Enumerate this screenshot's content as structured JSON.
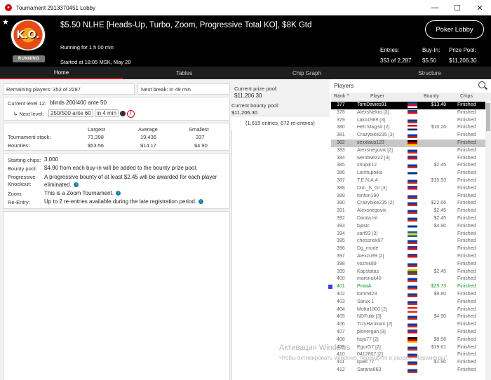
{
  "window": {
    "title": "Tournament 2913370451 Lobby",
    "buttons": [
      "—",
      "☐",
      "✕"
    ]
  },
  "header": {
    "badge_text": "K.O.",
    "running_label": "RUNNING",
    "title": "$5.50 NLHE [Heads-Up, Turbo, Zoom, Progressive Total KO], $8K Gtd",
    "running_for": "Running for 1 h 00 min",
    "started_at": "Started at 18:05 MSK, May 28",
    "poker_lobby_button": "Poker Lobby",
    "entries_label": "Entries:",
    "entries_value": "353 of 2,287",
    "buyin_label": "Buy-In:",
    "buyin_value": "$5.50",
    "prizepool_label": "Prize Pool:",
    "prizepool_value": "$11,206.30"
  },
  "tabs": [
    "Home",
    "Tables",
    "Chip Graph",
    "Structure"
  ],
  "home": {
    "remaining": "Remaining players: 353 of 2287",
    "next_break": "Next break: in 49 min",
    "current_level_label": "Current level 12:",
    "current_level_value": "blinds 200/400 ante 50",
    "next_level_label": "Next level:",
    "next_level_value": "250/500 ante 60",
    "next_level_time": "in 4 min",
    "alert_symbol": "!",
    "stack_headers": [
      "Largest",
      "Average",
      "Smallest"
    ],
    "stack_rows": [
      {
        "label": "Tournament stack:",
        "values": [
          "73,398",
          "19,436",
          "337"
        ]
      },
      {
        "label": "Bounties:",
        "values": [
          "$53.56",
          "$14.17",
          "$4.90"
        ]
      }
    ],
    "details": [
      {
        "label": "Starting chips:",
        "value": "3,000",
        "info": false
      },
      {
        "label": "Bounty pool:",
        "value": "$4.90 from each buy-in will be added to the bounty prize pool.",
        "info": false
      },
      {
        "label": "Progressive Knockout:",
        "value": "A progressive bounty of at least $2.45 will be awarded for each player eliminated.",
        "info": true
      },
      {
        "label": "Zoom:",
        "value": "This is a Zoom Tournament.",
        "info": true
      },
      {
        "label": "Re-Entry:",
        "value": "Up to 2 re-entries available during the late registration period.",
        "info": true
      }
    ],
    "prize_pool_label": "Current prize pool:",
    "prize_pool_value": "$11,206.30",
    "bounty_pool_label": "Current bounty pool:",
    "bounty_pool_value": "$11,206.30",
    "entries_note": "(1,615 entries, 672 re-entries)"
  },
  "players": {
    "title": "Players",
    "columns": [
      "Rank",
      "Player",
      "Bounty",
      "Chips"
    ],
    "rows": [
      {
        "rank": "377",
        "name": "TomDavies91",
        "flag": "gb",
        "bounty": "$13.48",
        "status": "Finished",
        "style": "sel"
      },
      {
        "rank": "378",
        "name": "AlexsNekro [3]",
        "flag": "gb",
        "bounty": "",
        "status": "Finished",
        "style": ""
      },
      {
        "rank": "379",
        "name": "cako1989 [3]",
        "flag": "ru",
        "bounty": "",
        "status": "Finished",
        "style": ""
      },
      {
        "rank": "380",
        "name": "Helt Magisk [2]",
        "flag": "no",
        "bounty": "$10.26",
        "status": "Finished",
        "style": ""
      },
      {
        "rank": "381",
        "name": "Crazybike235 [3]",
        "flag": "ru",
        "bounty": "",
        "status": "Finished",
        "style": ""
      },
      {
        "rank": "382",
        "name": "sexxlaus123",
        "flag": "de",
        "bounty": "",
        "status": "Finished",
        "style": "gray"
      },
      {
        "rank": "383",
        "name": "Alexsnegovik [2]",
        "flag": "ru",
        "bounty": "",
        "status": "Finished",
        "style": ""
      },
      {
        "rank": "384",
        "name": "weirdwez22 [3]",
        "flag": "gb",
        "bounty": "",
        "status": "Finished",
        "style": ""
      },
      {
        "rank": "385",
        "name": "snupik12",
        "flag": "ru",
        "bounty": "$2.45",
        "status": "Finished",
        "style": ""
      },
      {
        "rank": "386",
        "name": "Lanttupoika",
        "flag": "fi",
        "bounty": "",
        "status": "Finished",
        "style": ""
      },
      {
        "rank": "387",
        "name": "T.E.N.A.4",
        "flag": "ru",
        "bounty": "$15.93",
        "status": "Finished",
        "style": ""
      },
      {
        "rank": "388",
        "name": "Dim_S_Gr [3]",
        "flag": "gb",
        "bounty": "",
        "status": "Finished",
        "style": ""
      },
      {
        "rank": "389",
        "name": "tonton190",
        "flag": "ru",
        "bounty": "",
        "status": "Finished",
        "style": ""
      },
      {
        "rank": "390",
        "name": "Crazybike235 [2]",
        "flag": "ru",
        "bounty": "$22.66",
        "status": "Finished",
        "style": ""
      },
      {
        "rank": "391",
        "name": "Alexsnegovik",
        "flag": "ru",
        "bounty": "$2.45",
        "status": "Finished",
        "style": ""
      },
      {
        "rank": "392",
        "name": "Danila.lnt",
        "flag": "ru",
        "bounty": "$2.45",
        "status": "Finished",
        "style": ""
      },
      {
        "rank": "393",
        "name": "bjasic",
        "flag": "fi",
        "bounty": "$4.90",
        "status": "Finished",
        "style": ""
      },
      {
        "rank": "394",
        "name": "xarf93 [3]",
        "flag": "se",
        "bounty": "",
        "status": "Finished",
        "style": ""
      },
      {
        "rank": "395",
        "name": "chessnok97",
        "flag": "ru",
        "bounty": "",
        "status": "Finished",
        "style": ""
      },
      {
        "rank": "396",
        "name": "Dg_mode",
        "flag": "gb",
        "bounty": "",
        "status": "Finished",
        "style": ""
      },
      {
        "rank": "397",
        "name": "Alexzu99 [2]",
        "flag": "gb",
        "bounty": "",
        "status": "Finished",
        "style": ""
      },
      {
        "rank": "398",
        "name": "voznik89",
        "flag": "ru",
        "bounty": "",
        "status": "Finished",
        "style": ""
      },
      {
        "rank": "399",
        "name": "Kapstatas",
        "flag": "lt",
        "bounty": "$2.45",
        "status": "Finished",
        "style": ""
      },
      {
        "rank": "400",
        "name": "martinuk40",
        "flag": "ru",
        "bounty": "",
        "status": "Finished",
        "style": ""
      },
      {
        "rank": "401",
        "name": "PiniaA",
        "flag": "ru",
        "bounty": "$25.73",
        "status": "Finished",
        "style": "green"
      },
      {
        "rank": "402",
        "name": "lommit23",
        "flag": "ru",
        "bounty": "$9.80",
        "status": "Finished",
        "style": ""
      },
      {
        "rank": "403",
        "name": "Sarux 1",
        "flag": "ru",
        "bounty": "",
        "status": "Finished",
        "style": ""
      },
      {
        "rank": "404",
        "name": "Motta1800 [2]",
        "flag": "ca",
        "bounty": "",
        "status": "Finished",
        "style": ""
      },
      {
        "rank": "405",
        "name": "NDFulik [3]",
        "flag": "ru",
        "bounty": "$4.90",
        "status": "Finished",
        "style": ""
      },
      {
        "rank": "406",
        "name": "TrzyHznikam [2]",
        "flag": "ru",
        "bounty": "",
        "status": "Finished",
        "style": ""
      },
      {
        "rank": "407",
        "name": "plonergan [3]",
        "flag": "gb",
        "bounty": "",
        "status": "Finished",
        "style": ""
      },
      {
        "rank": "408",
        "name": "huju77 [2]",
        "flag": "de",
        "bounty": "$8.58",
        "status": "Finished",
        "style": ""
      },
      {
        "rank": "409",
        "name": "EgorG7 [2]",
        "flag": "ru",
        "bounty": "$19.61",
        "status": "Finished",
        "style": ""
      },
      {
        "rank": "410",
        "name": "0412807 [2]",
        "flag": "ru",
        "bounty": "",
        "status": "Finished",
        "style": ""
      },
      {
        "rank": "411",
        "name": "quell 77",
        "flag": "ru",
        "bounty": "$1.90",
        "status": "Finished",
        "style": ""
      },
      {
        "rank": "412",
        "name": "Sarana663",
        "flag": "ru",
        "bounty": "",
        "status": "Finished",
        "style": ""
      }
    ]
  },
  "flag_colors": {
    "gb": [
      "#21468b",
      "#c8102e",
      "#ffffff"
    ],
    "ru": [
      "#ffffff",
      "#0039a6",
      "#d52b1e"
    ],
    "no": [
      "#ba0c2f",
      "#ffffff",
      "#00205b"
    ],
    "de": [
      "#000000",
      "#dd0000",
      "#ffce00"
    ],
    "fi": [
      "#ffffff",
      "#003580",
      "#ffffff"
    ],
    "se": [
      "#006aa7",
      "#fecc00",
      "#006aa7"
    ],
    "lt": [
      "#fdb913",
      "#006a44",
      "#c1272d"
    ],
    "ca": [
      "#d52b1e",
      "#ffffff",
      "#d52b1e"
    ]
  },
  "watermark": {
    "line1": "Активация Windows",
    "line2": "Чтобы активировать Windows, перейдите в раздел \"Параметры\"."
  }
}
